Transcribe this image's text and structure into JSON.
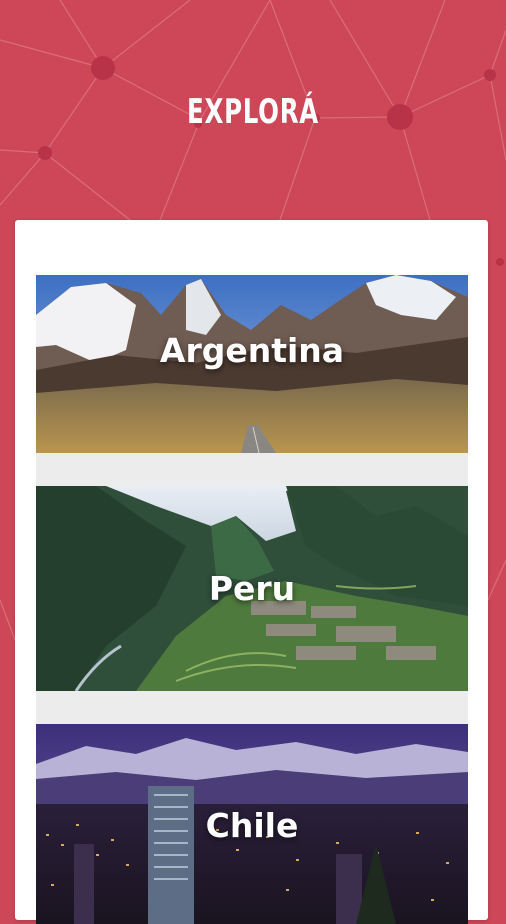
{
  "header": {
    "title": "EXPLORÁ"
  },
  "destinations": [
    {
      "name": "Argentina",
      "scene": "patagonia-mountain-road-photo"
    },
    {
      "name": "Peru",
      "scene": "machu-picchu-ruins-photo"
    },
    {
      "name": "Chile",
      "scene": "santiago-city-night-andes-photo"
    }
  ],
  "colors": {
    "background": "#cd4758",
    "card": "#ffffff",
    "list_gap": "#ececec",
    "label": "#ffffff"
  }
}
